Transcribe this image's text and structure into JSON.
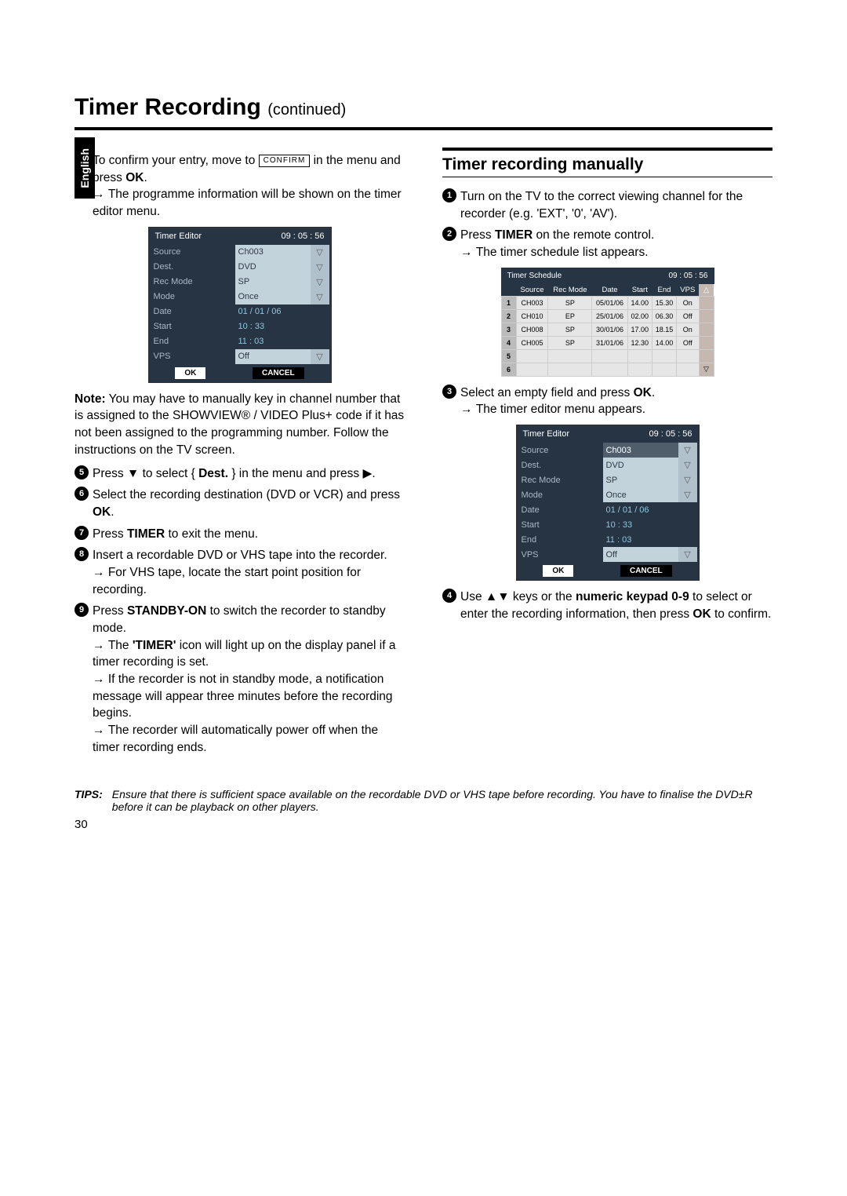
{
  "lang": "English",
  "pageTitle": "Timer Recording",
  "pageTitleSuffix": "(continued)",
  "leftCol": {
    "step4": "To confirm your entry, move to",
    "step4confirm": "CONFIRM",
    "step4b": "in the menu and press",
    "step4c": "OK",
    "step4note": "The programme information will be shown on the timer editor menu.",
    "noteLabel": "Note:",
    "note": "You may have to manually key in channel number that is assigned to the SHOWVIEW® / VIDEO Plus+ code if it has not been assigned to the programming number.  Follow the instructions on the TV screen.",
    "step5a": "Press ▼ to select {",
    "step5b": "Dest.",
    "step5c": "} in the menu and press ▶.",
    "step6": "Select the recording destination (DVD or VCR) and press",
    "step6ok": "OK",
    "step7": "Press",
    "step7b": "TIMER",
    "step7c": "to exit the menu.",
    "step8": "Insert a recordable DVD or VHS tape into the recorder.",
    "step8note": "For VHS tape, locate the start point position for recording.",
    "step9a": "Press",
    "step9b": "STANDBY-ON",
    "step9c": "to switch the recorder to standby mode.",
    "step9n1a": "The ",
    "step9n1b": "'TIMER'",
    "step9n1c": " icon will light up on the display panel if a timer recording is set.",
    "step9n2": "If the recorder is not in standby mode, a notification message will appear three minutes before the recording begins.",
    "step9n3": "The recorder will automatically power off when the timer recording ends."
  },
  "rightCol": {
    "heading": "Timer recording manually",
    "step1": "Turn on the TV to the correct viewing channel for the recorder (e.g. 'EXT', '0', 'AV').",
    "step2a": "Press",
    "step2b": "TIMER",
    "step2c": "on the remote control.",
    "step2note": "The timer schedule list appears.",
    "step3a": "Select an empty field and press",
    "step3b": "OK",
    "step3note": "The timer editor menu appears.",
    "step4a": "Use ▲▼ keys or the",
    "step4b": "numeric keypad 0-9",
    "step4c": "to select or enter the recording information, then press",
    "step4d": "OK",
    "step4e": "to confirm."
  },
  "editor": {
    "title": "Timer Editor",
    "time": "09 : 05 : 56",
    "rows": [
      {
        "label": "Source",
        "value": "Ch003",
        "dd": true
      },
      {
        "label": "Dest.",
        "value": "DVD",
        "dd": true
      },
      {
        "label": "Rec Mode",
        "value": "SP",
        "dd": true
      },
      {
        "label": "Mode",
        "value": "Once",
        "dd": true
      },
      {
        "label": "Date",
        "value": "01 / 01 / 06",
        "dd": false,
        "plain": true
      },
      {
        "label": "Start",
        "value": "10 : 33",
        "dd": false,
        "plain": true
      },
      {
        "label": "End",
        "value": "11 : 03",
        "dd": false,
        "plain": true
      },
      {
        "label": "VPS",
        "value": "Off",
        "dd": true
      }
    ],
    "ok": "OK",
    "cancel": "CANCEL"
  },
  "schedule": {
    "title": "Timer Schedule",
    "time": "09 : 05 : 56",
    "headers": [
      "",
      "Source",
      "Rec Mode",
      "Date",
      "Start",
      "End",
      "VPS",
      ""
    ],
    "rows": [
      [
        "1",
        "CH003",
        "SP",
        "05/01/06",
        "14.00",
        "15.30",
        "On"
      ],
      [
        "2",
        "CH010",
        "EP",
        "25/01/06",
        "02.00",
        "06.30",
        "Off"
      ],
      [
        "3",
        "CH008",
        "SP",
        "30/01/06",
        "17.00",
        "18.15",
        "On"
      ],
      [
        "4",
        "CH005",
        "SP",
        "31/01/06",
        "12.30",
        "14.00",
        "Off"
      ],
      [
        "5",
        "",
        "",
        "",
        "",
        "",
        ""
      ],
      [
        "6",
        "",
        "",
        "",
        "",
        "",
        ""
      ]
    ]
  },
  "tips": {
    "label": "TIPS:",
    "text": "Ensure that there is sufficient space available on the recordable DVD or VHS tape before recording. You have to finalise the DVD±R before it can be playback on other players."
  },
  "pageNumber": "30"
}
